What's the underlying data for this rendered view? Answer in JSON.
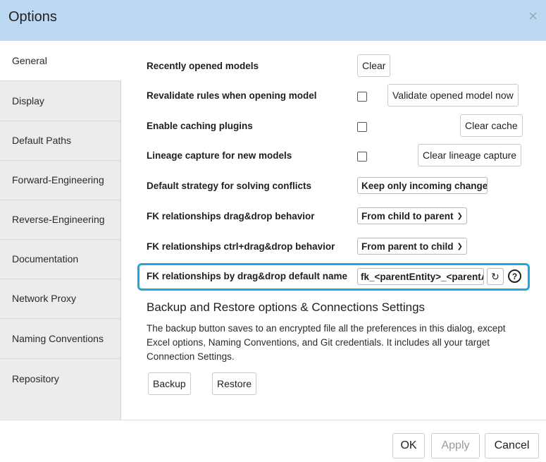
{
  "dialog": {
    "title": "Options",
    "close_symbol": "×"
  },
  "sidebar": {
    "items": [
      {
        "label": "General",
        "active": true
      },
      {
        "label": "Display"
      },
      {
        "label": "Default Paths"
      },
      {
        "label": "Forward-Engineering"
      },
      {
        "label": "Reverse-Engineering"
      },
      {
        "label": "Documentation"
      },
      {
        "label": "Network Proxy"
      },
      {
        "label": "Naming Conventions"
      },
      {
        "label": "Repository"
      }
    ]
  },
  "general": {
    "recent_models": {
      "label": "Recently opened models",
      "button": "Clear"
    },
    "revalidate": {
      "label": "Revalidate rules when opening model",
      "checked": false,
      "button": "Validate opened model now"
    },
    "caching": {
      "label": "Enable caching plugins",
      "checked": false,
      "button": "Clear cache"
    },
    "lineage": {
      "label": "Lineage capture for new models",
      "checked": false,
      "button": "Clear lineage capture"
    },
    "conflicts": {
      "label": "Default strategy for solving conflicts",
      "value": "Keep only incoming changes"
    },
    "fk_drag": {
      "label": "FK relationships drag&drop behavior",
      "value": "From child to parent"
    },
    "fk_ctrl_drag": {
      "label": "FK relationships ctrl+drag&drop behavior",
      "value": "From parent to child"
    },
    "fk_name": {
      "label": "FK relationships by drag&drop default name",
      "value": "fk_<parentEntity>_<parentAttribute>"
    },
    "backup": {
      "title": "Backup and Restore options & Connections Settings",
      "description": "The backup button saves to an encrypted file all the preferences in this dialog, except Excel options, Naming Conventions, and Git credentials. It includes all your target Connection Settings.",
      "backup_button": "Backup",
      "restore_button": "Restore"
    }
  },
  "footer": {
    "ok": "OK",
    "apply": "Apply",
    "cancel": "Cancel"
  },
  "colors": {
    "titlebar": "#bcd8f3",
    "highlight": "#1fa8e0",
    "sidebar": "#ececec"
  }
}
